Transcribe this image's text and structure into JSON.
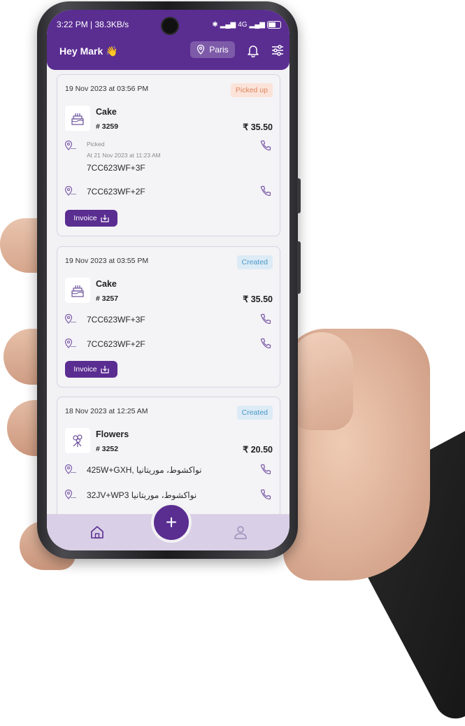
{
  "status_bar": {
    "time_speed": "3:22 PM | 38.3KB/s",
    "network": "4G"
  },
  "header": {
    "greeting": "Hey Mark 👋",
    "location": "Paris",
    "icons": [
      "location-pin-icon",
      "bell-icon",
      "filter-sliders-icon"
    ]
  },
  "orders": [
    {
      "date": "19 Nov 2023 at 03:56 PM",
      "status": "Picked up",
      "item": "Cake",
      "order_no": "# 3259",
      "price": "₹ 35.50",
      "pickup_status": "Picked",
      "pickup_time": "At 21 Nov 2023 at 11:23 AM",
      "pickup": "7CC623WF+3F",
      "drop": "7CC623WF+2F",
      "invoice": "Invoice"
    },
    {
      "date": "19 Nov 2023 at 03:55 PM",
      "status": "Created",
      "item": "Cake",
      "order_no": "# 3257",
      "price": "₹ 35.50",
      "pickup": "7CC623WF+3F",
      "drop": "7CC623WF+2F",
      "invoice": "Invoice"
    },
    {
      "date": "18 Nov 2023 at 12:25 AM",
      "status": "Created",
      "item": "Flowers",
      "order_no": "# 3252",
      "price": "₹ 20.50",
      "pickup": "425W+GXH, نواكشوط، موريتانيا",
      "drop": "32JV+WP3 نواكشوط، موريتانيا"
    }
  ],
  "nav": {
    "items": [
      "home-icon",
      "add-icon",
      "profile-icon"
    ],
    "fab_label": "+"
  },
  "colors": {
    "primary": "#5a2d91",
    "picked_badge_bg": "#fbe3d9",
    "picked_badge_text": "#e0855d",
    "created_badge_bg": "#dcebf5",
    "created_badge_text": "#4a98c9"
  }
}
